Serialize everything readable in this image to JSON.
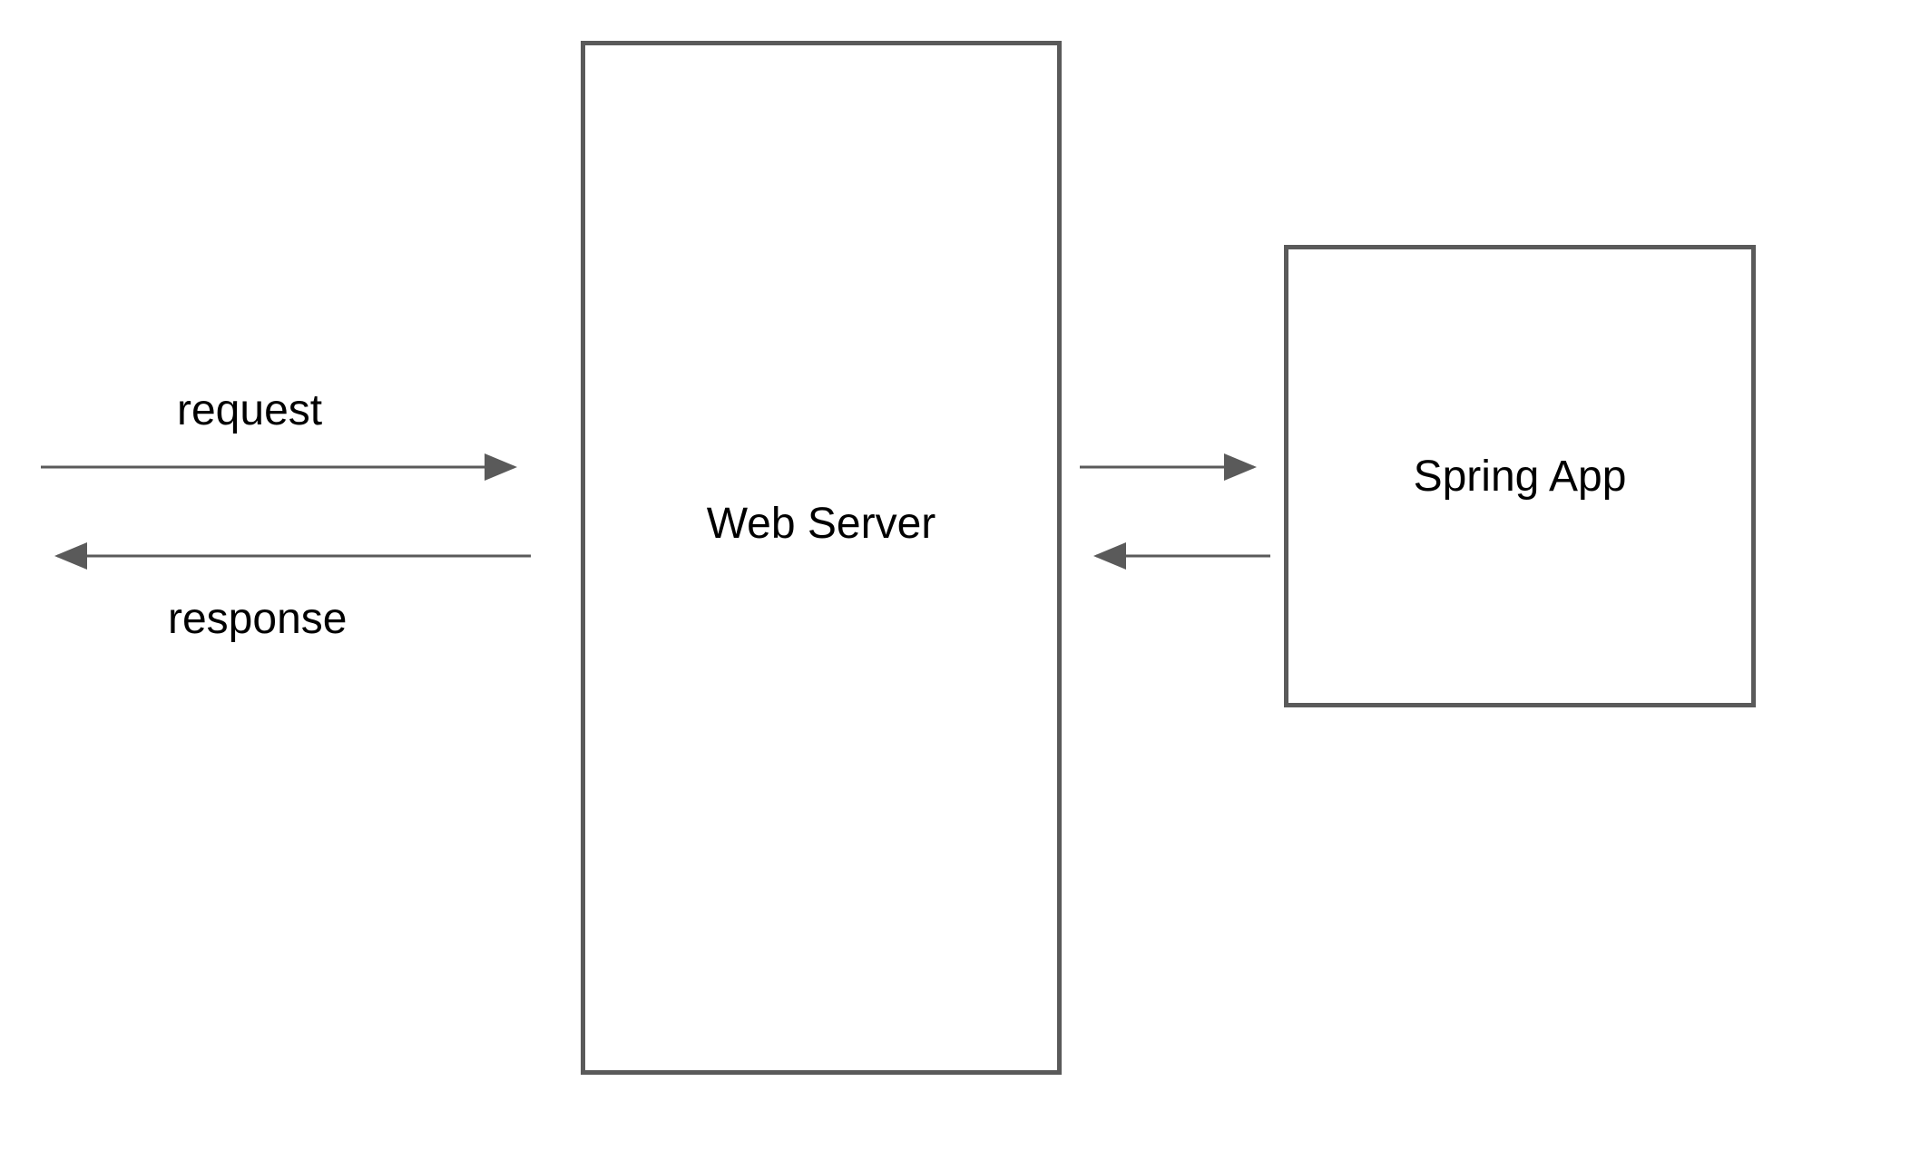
{
  "nodes": {
    "web_server": {
      "label": "Web Server"
    },
    "spring_app": {
      "label": "Spring App"
    }
  },
  "edges": {
    "client_to_server": {
      "label": "request"
    },
    "server_to_client": {
      "label": "response"
    }
  },
  "colors": {
    "border": "#5a5a5a",
    "arrow": "#5a5a5a",
    "text": "#000000"
  }
}
